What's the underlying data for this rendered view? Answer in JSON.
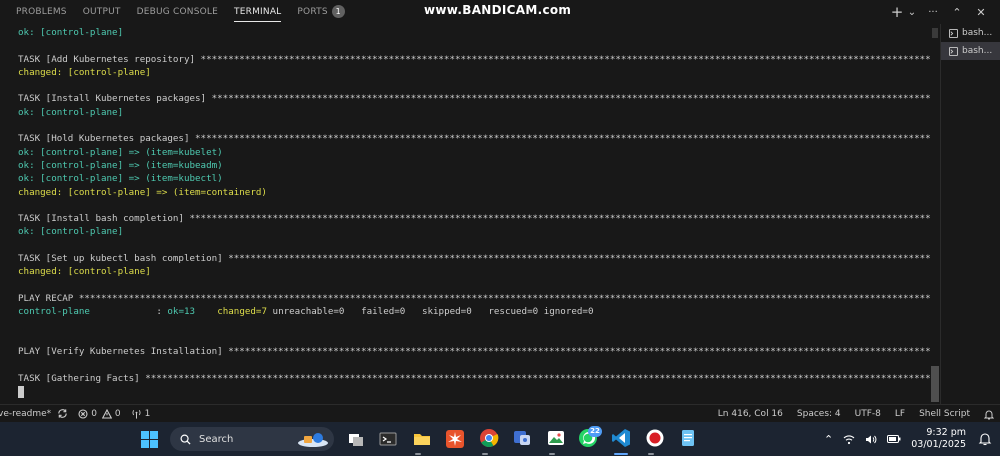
{
  "panel": {
    "tabs": [
      {
        "label": "PROBLEMS",
        "active": false
      },
      {
        "label": "OUTPUT",
        "active": false
      },
      {
        "label": "DEBUG CONSOLE",
        "active": false
      },
      {
        "label": "TERMINAL",
        "active": true
      },
      {
        "label": "PORTS",
        "active": false
      }
    ],
    "ports_count": "1",
    "watermark": "www.BANDICAM.com",
    "actions": {
      "new_terminal": "+",
      "dropdown": "⌄",
      "more": "···",
      "maximize": "⌃",
      "close": "✕"
    }
  },
  "terminal": {
    "lines": [
      {
        "text": "ok: [control-plane]",
        "color": "green"
      },
      {
        "text": "",
        "color": "default"
      },
      {
        "text": "TASK [Add Kubernetes repository] ************************************************************************************************************************************************************",
        "color": "default"
      },
      {
        "text": "changed: [control-plane]",
        "color": "yellow"
      },
      {
        "text": "",
        "color": "default"
      },
      {
        "text": "TASK [Install Kubernetes packages] **********************************************************************************************************************************************************",
        "color": "default"
      },
      {
        "text": "ok: [control-plane]",
        "color": "green"
      },
      {
        "text": "",
        "color": "default"
      },
      {
        "text": "TASK [Hold Kubernetes packages] *************************************************************************************************************************************************************",
        "color": "default"
      },
      {
        "text": "ok: [control-plane] => (item=kubelet)",
        "color": "green"
      },
      {
        "text": "ok: [control-plane] => (item=kubeadm)",
        "color": "green"
      },
      {
        "text": "ok: [control-plane] => (item=kubectl)",
        "color": "green"
      },
      {
        "text": "changed: [control-plane] => (item=containerd)",
        "color": "yellow"
      },
      {
        "text": "",
        "color": "default"
      },
      {
        "text": "TASK [Install bash completion] **************************************************************************************************************************************************************",
        "color": "default"
      },
      {
        "text": "ok: [control-plane]",
        "color": "green"
      },
      {
        "text": "",
        "color": "default"
      },
      {
        "text": "TASK [Set up kubectl bash completion] *******************************************************************************************************************************************************",
        "color": "default"
      },
      {
        "text": "changed: [control-plane]",
        "color": "yellow"
      },
      {
        "text": "",
        "color": "default"
      },
      {
        "text": "PLAY RECAP ******************************************************************************************************************************************************************************",
        "color": "default"
      },
      {
        "text": "",
        "color": "recap"
      },
      {
        "text": "",
        "color": "default"
      },
      {
        "text": "",
        "color": "default"
      },
      {
        "text": "PLAY [Verify Kubernetes Installation] ***************************************************************************************************************************************************",
        "color": "default"
      },
      {
        "text": "",
        "color": "default"
      },
      {
        "text": "TASK [Gathering Facts] ******************************************************************************************************************************************************************",
        "color": "default"
      }
    ],
    "recap": {
      "host": "control-plane",
      "colon": ": ",
      "ok": "ok=13",
      "changed": "changed=7",
      "unreachable": "unreachable=0",
      "failed": "failed=0",
      "skipped": "skipped=0",
      "rescued": "rescued=0",
      "ignored": "ignored=0"
    }
  },
  "terminal_list": [
    {
      "label": "bash...",
      "selected": false
    },
    {
      "label": "bash...",
      "selected": true
    }
  ],
  "statusbar": {
    "left": {
      "branch": "ve-readme*",
      "errors": "0",
      "warnings": "0",
      "ports": "1"
    },
    "right": {
      "cursor": "Ln 416, Col 16",
      "spaces": "Spaces: 4",
      "encoding": "UTF-8",
      "eol": "LF",
      "language": "Shell Script"
    }
  },
  "taskbar": {
    "search_label": "Search",
    "whatsapp_badge": "22",
    "time": "9:32 pm",
    "date": "03/01/2025"
  },
  "colors": {
    "green": "#4ec9b0",
    "yellow": "#dcdc4a",
    "default": "#cccccc",
    "panel_bg": "#181818",
    "taskbar_bg": "#1c2431"
  }
}
